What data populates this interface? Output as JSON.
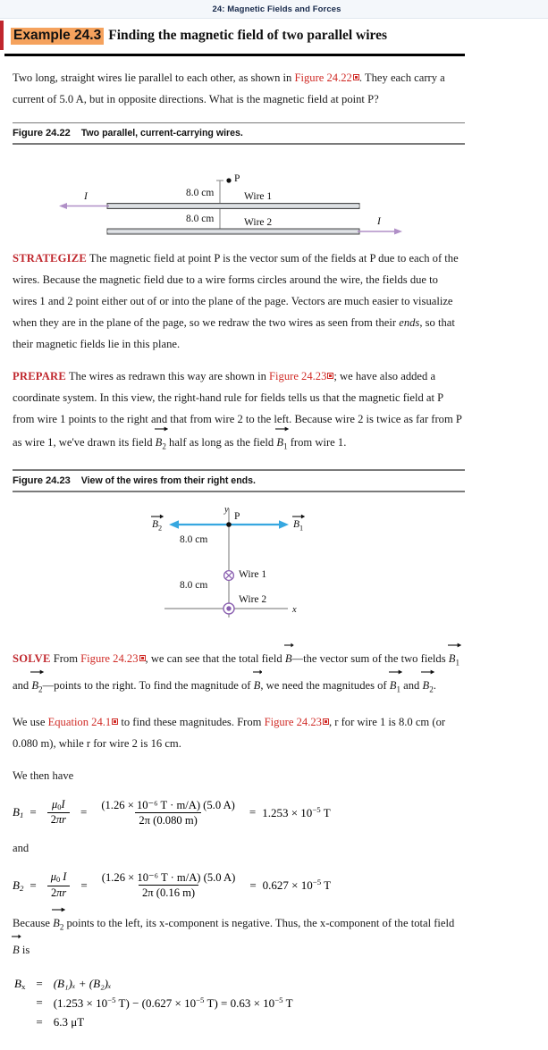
{
  "chapter": {
    "title": "24: Magnetic Fields and Forces"
  },
  "example": {
    "label": "Example 24.3",
    "title": "Finding the magnetic field of two parallel wires"
  },
  "problem": {
    "line1_a": "Two long, straight wires lie parallel to each other, as shown in ",
    "line1_ref": "Figure 24.22",
    "line1_b": ". They each carry a current of 5.0 A, but in opposite directions. What is the magnetic field at point P?"
  },
  "figure22": {
    "number": "Figure 24.22",
    "caption": "Two parallel, current-carrying wires.",
    "labels": {
      "point_p": "P",
      "dist_top": "8.0 cm",
      "dist_bottom": "8.0 cm",
      "wire1": "Wire 1",
      "wire2": "Wire 2",
      "current_left": "I",
      "current_right": "I"
    },
    "colors": {
      "wire_fill": "#c9cdd2",
      "wire_stroke": "#4a4a4a",
      "current_arrow": "#b08fc7"
    }
  },
  "strategize": {
    "keyword": "STRATEGIZE",
    "text_a": " The magnetic field at point P is the vector sum of the fields at P due to each of the wires. Because the magnetic field due to a wire forms circles around the wire, the fields due to wires 1 and 2 point either out of or into the plane of the page. Vectors are much easier to visualize when they are in the plane of the page, so we redraw the two wires as seen from their ",
    "emph": "ends",
    "text_b": ", so that their magnetic fields lie in this plane."
  },
  "prepare": {
    "keyword": "PREPARE",
    "text_a": " The wires as redrawn this way are shown in ",
    "ref": "Figure 24.23",
    "text_b": "; we have also added a coordinate system. In this view, the right-hand rule for fields tells us that the magnetic field at P from wire 1 points to the right and that from wire 2 to the left. Because wire 2 is twice as far from P as wire 1, we've drawn its field ",
    "b2": "B",
    "b2sub": "2",
    "text_c": " half as long as the field ",
    "b1": "B",
    "b1sub": "1",
    "text_d": " from wire 1."
  },
  "figure23": {
    "number": "Figure 24.23",
    "caption": "View of the wires from their right ends.",
    "labels": {
      "axis_y": "y",
      "axis_x": "x",
      "point_p": "P",
      "b2": "B",
      "b2_sub": "2",
      "b1": "B",
      "b1_sub": "1",
      "dist_top": "8.0 cm",
      "dist_bottom": "8.0 cm",
      "wire1": "Wire 1",
      "wire2": "Wire 2"
    },
    "colors": {
      "field_arrow": "#36a7e0",
      "wire_symbol": "#8a5fb0",
      "axis": "#8c8c8c"
    }
  },
  "solve": {
    "keyword": "SOLVE",
    "text_a": " From ",
    "ref1": "Figure 24.23",
    "text_b": ", we can see that the total field ",
    "bvec": "B",
    "text_c": "—the vector sum of the two fields ",
    "b1": "B",
    "b1sub": "1",
    "text_d": " and ",
    "b2": "B",
    "b2sub": "2",
    "text_e": "—points to the right. To find the magnitude of ",
    "bvec2": "B",
    "text_f": ", we need the magnitudes of ",
    "b1b": "B",
    "b1bsub": "1",
    "text_g": " and ",
    "b2b": "B",
    "b2bsub": "2",
    "text_h": "."
  },
  "equation_intro": {
    "text_a": "We use ",
    "ref_eq": "Equation 24.1",
    "text_b": " to find these magnitudes. From ",
    "ref_fig": "Figure 24.23",
    "text_c": ", r for wire 1 is 8.0 cm (or 0.080 m), while r for wire 2 is 16 cm.",
    "we_then_have": "We then have",
    "and": "and"
  },
  "eq_b1": {
    "lhs": "B",
    "lhs_sub": "1",
    "frac1_num": "μ",
    "frac1_num_sub": "0",
    "frac1_num_i": "I",
    "frac1_den_pre": "2",
    "frac1_den_pi": "π",
    "frac1_den_r": "r",
    "frac2_num": "(1.26 × 10⁻⁶ T · m/A) (5.0 A)",
    "frac2_den": "2π (0.080 m)",
    "result_pre": "1.253 × 10",
    "result_exp": "−5",
    "result_unit": " T"
  },
  "eq_b2": {
    "lhs": "B",
    "lhs_sub": "2",
    "frac1_num": "μ",
    "frac1_num_sub": "0",
    "frac1_num_i": "I",
    "frac1_den_pre": "2",
    "frac1_den_pi": "π",
    "frac1_den_r": "r",
    "frac2_num": "(1.26 × 10⁻⁶ T · m/A) (5.0 A)",
    "frac2_den": "2π (0.16 m)",
    "result_pre": "0.627 × 10",
    "result_exp": "−5",
    "result_unit": " T"
  },
  "because": {
    "text_a": "Because ",
    "b2": "B",
    "b2sub": "2",
    "text_b": " points to the left, its x-component is negative. Thus, the x-component of the total field ",
    "bvec": "B",
    "text_c": " is"
  },
  "final": {
    "lhs": "B",
    "lhs_sub": "x",
    "row1": "(B₁)ₓ + (B₂)ₓ",
    "row2_a": "(1.253 × 10",
    "row2_e1": "−5",
    "row2_b": " T) − (0.627 × 10",
    "row2_e2": "−5",
    "row2_c": " T) = 0.63 × 10",
    "row2_e3": "−5",
    "row2_d": " T",
    "row3": "6.3 μT",
    "eq": "="
  },
  "chart_data": {
    "type": "diagram",
    "figures": [
      {
        "name": "Figure 24.22 — side view of two parallel wires",
        "wire1_current_direction": "left",
        "wire2_current_direction": "right",
        "distance_P_to_wire1_cm": 8.0,
        "distance_wire1_to_wire2_cm": 8.0,
        "current_A": 5.0
      },
      {
        "name": "Figure 24.23 — end view with coordinate axes",
        "wire1_symbol": "cross (into page)",
        "wire2_symbol": "dot (out of page)",
        "B1_direction": "+x (right)",
        "B2_direction": "-x (left)",
        "B1_relative_length": 1.0,
        "B2_relative_length": 0.5,
        "distance_P_to_wire1_cm": 8.0,
        "distance_wire1_to_wire2_cm": 8.0
      }
    ],
    "computed": {
      "B1_T": 1.253e-05,
      "B2_T": 6.27e-06,
      "Bx_T": 6.3e-06,
      "Bx_microT": 6.3
    }
  }
}
